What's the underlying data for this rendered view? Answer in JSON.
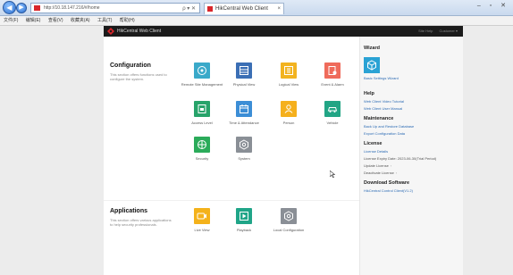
{
  "browser": {
    "address": "http://10.18.147.216/#/home",
    "tab_title": "HikCentral Web Client",
    "tab_close": "×",
    "address_tools": "ρ ▾ ✕",
    "window_controls": "– ▫ ✕",
    "back_icon": "◀",
    "forward_icon": "▶",
    "menu": [
      "文件(F)",
      "编辑(E)",
      "查看(V)",
      "收藏夹(A)",
      "工具(T)",
      "帮助(H)"
    ]
  },
  "header": {
    "app_title": "HikCentral Web Client",
    "right_items": [
      "Site Help",
      "Customer ▾"
    ]
  },
  "configuration": {
    "title": "Configuration",
    "description": "This section offers functions used to configure the system.",
    "tiles": [
      {
        "label": "Remote Site Management",
        "color": "#3aa9c9",
        "icon": "sites-icon"
      },
      {
        "label": "Physical View",
        "color": "#3b6fb5",
        "icon": "physical-view-icon"
      },
      {
        "label": "Logical View",
        "color": "#f2b320",
        "icon": "logical-view-icon"
      },
      {
        "label": "Event & Alarm",
        "color": "#ef6b5b",
        "icon": "event-alarm-icon"
      },
      {
        "label": "Access Level",
        "color": "#27a36a",
        "icon": "access-level-icon"
      },
      {
        "label": "Time & Attendance",
        "color": "#3c8ed6",
        "icon": "attendance-icon"
      },
      {
        "label": "Person",
        "color": "#f5b01d",
        "icon": "person-icon"
      },
      {
        "label": "Vehicle",
        "color": "#22a585",
        "icon": "vehicle-icon"
      },
      {
        "label": "Security",
        "color": "#2bab5a",
        "icon": "security-icon"
      },
      {
        "label": "System",
        "color": "#8a8f96",
        "icon": "system-icon"
      }
    ]
  },
  "applications": {
    "title": "Applications",
    "description": "This section offers various applications to help security professionals.",
    "tiles": [
      {
        "label": "Live View",
        "color": "#f4b21b",
        "icon": "live-view-icon"
      },
      {
        "label": "Playback",
        "color": "#20a588",
        "icon": "playback-icon"
      },
      {
        "label": "Local Configuration",
        "color": "#8a8f96",
        "icon": "local-config-icon"
      }
    ]
  },
  "right_panel": {
    "wizard": {
      "heading": "Wizard",
      "link": "Basic Settings Wizard"
    },
    "help": {
      "heading": "Help",
      "links": [
        "Web Client Video Tutorial",
        "Web Client User Manual"
      ]
    },
    "maintenance": {
      "heading": "Maintenance",
      "links": [
        "Back Up and Restore Database",
        "Export Configuration Data"
      ]
    },
    "license": {
      "heading": "License",
      "link": "License Details",
      "expiry": "License Expiry Date: 2023-06-30(Trial Period)",
      "items": [
        "Update License",
        "Deactivate License"
      ]
    },
    "download": {
      "heading": "Download Software",
      "link": "HikCentral Control Client(V1.2)"
    }
  },
  "colors": {
    "accent": "#2c6bb4",
    "header_bg": "#1b1b1b",
    "brand_red": "#d9262b"
  }
}
